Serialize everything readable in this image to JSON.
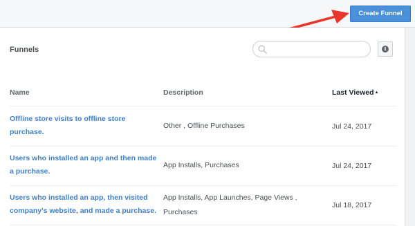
{
  "toolbar": {
    "create_label": "Create Funnel"
  },
  "panel": {
    "title": "Funnels",
    "search_placeholder": "",
    "info_glyph": "i"
  },
  "table": {
    "columns": {
      "name": "Name",
      "description": "Description",
      "last_viewed": "Last Viewed"
    },
    "sort_indicator": "▲",
    "rows": [
      {
        "name": "Offline store visits to offline store purchase.",
        "description": "Other , Offline Purchases",
        "last_viewed": "Jul 24, 2017"
      },
      {
        "name": "Users who installed an app and then made a purchase.",
        "description": "App Installs, Purchases",
        "last_viewed": "Jul 24, 2017"
      },
      {
        "name": "Users who installed an app, then visited company's website, and made a purchase.",
        "description": "App Installs, App Launches, Page Views , Purchases",
        "last_viewed": "Jul 18, 2017"
      }
    ]
  },
  "colors": {
    "accent": "#4a90d9",
    "link": "#4080c8",
    "annotation_arrow": "#e8372a"
  },
  "icons": [
    "search-icon",
    "info-icon",
    "sort-up-icon",
    "annotation-arrow-icon"
  ]
}
